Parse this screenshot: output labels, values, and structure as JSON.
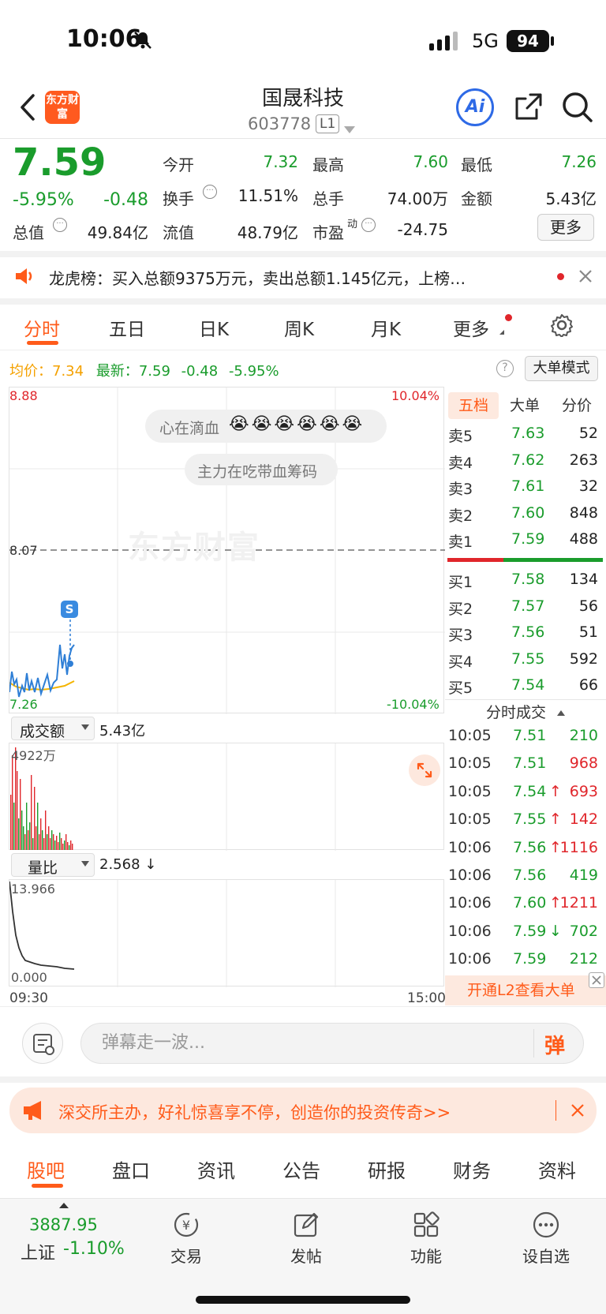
{
  "status": {
    "time": "10:06",
    "network": "5G",
    "battery": "94"
  },
  "header": {
    "title": "国晟科技",
    "code": "603778",
    "level": "L1",
    "logo_text": "东方财富",
    "ai_label": "Ai"
  },
  "quote": {
    "price": "7.59",
    "change_pct": "-5.95%",
    "change": "-0.48",
    "open_label": "今开",
    "open": "7.32",
    "high_label": "最高",
    "high": "7.60",
    "low_label": "最低",
    "low": "7.26",
    "turnover_label": "换手",
    "turnover": "11.51%",
    "volume_label": "总手",
    "volume": "74.00万",
    "amount_label": "金额",
    "amount": "5.43亿",
    "mktcap_label": "总值",
    "mktcap": "49.84亿",
    "float_label": "流值",
    "float": "48.79亿",
    "pe_label": "市盈",
    "pe_sup": "动",
    "pe": "-24.75",
    "more_label": "更多"
  },
  "notice": {
    "text": "龙虎榜：买入总额9375万元，卖出总额1.145亿元，上榜…"
  },
  "tabs": [
    "分时",
    "五日",
    "日K",
    "周K",
    "月K",
    "更多"
  ],
  "avg": {
    "avg_label": "均价：",
    "avg_value": "7.34",
    "latest_label": "最新：",
    "latest_value": "7.59",
    "change": "-0.48",
    "change_pct": "-5.95%"
  },
  "mode_button": "大单模式",
  "chart": {
    "price_high": "8.88",
    "price_mid": "8.07",
    "price_low": "7.26",
    "pct_high": "10.04%",
    "pct_low": "-10.04%",
    "watermark": "东方财富",
    "bubble1": "心在滴血",
    "bubble2": "主力在吃带血筹码",
    "signal": "S",
    "colors": {
      "price_line": "#2f7fd6",
      "avg_line": "#f4b400",
      "up": "#e0262b",
      "down": "#1a9c2c"
    },
    "volume_label": "成交额",
    "volume_total": "5.43亿",
    "volume_max": "4922万",
    "ratio_label": "量比",
    "ratio_value": "2.568 ↓",
    "ratio_max": "13.966",
    "ratio_min": "0.000",
    "time_start": "09:30",
    "time_end": "15:00"
  },
  "orderbook": {
    "tabs": [
      "五档",
      "大单",
      "分价"
    ],
    "asks": [
      {
        "label": "卖5",
        "price": "7.63",
        "vol": "52"
      },
      {
        "label": "卖4",
        "price": "7.62",
        "vol": "263"
      },
      {
        "label": "卖3",
        "price": "7.61",
        "vol": "32"
      },
      {
        "label": "卖2",
        "price": "7.60",
        "vol": "848"
      },
      {
        "label": "卖1",
        "price": "7.59",
        "vol": "488"
      }
    ],
    "bids": [
      {
        "label": "买1",
        "price": "7.58",
        "vol": "134"
      },
      {
        "label": "买2",
        "price": "7.57",
        "vol": "56"
      },
      {
        "label": "买3",
        "price": "7.56",
        "vol": "51"
      },
      {
        "label": "买4",
        "price": "7.55",
        "vol": "592"
      },
      {
        "label": "买5",
        "price": "7.54",
        "vol": "66"
      }
    ]
  },
  "trades": {
    "title": "分时成交",
    "rows": [
      {
        "time": "10:05",
        "price": "7.51",
        "arrow": "",
        "vol": "210",
        "dir": "down"
      },
      {
        "time": "10:05",
        "price": "7.51",
        "arrow": "",
        "vol": "968",
        "dir": "up"
      },
      {
        "time": "10:05",
        "price": "7.54",
        "arrow": "↑",
        "vol": "693",
        "dir": "up"
      },
      {
        "time": "10:05",
        "price": "7.55",
        "arrow": "↑",
        "vol": "142",
        "dir": "up"
      },
      {
        "time": "10:06",
        "price": "7.56",
        "arrow": "↑",
        "vol": "1116",
        "dir": "up"
      },
      {
        "time": "10:06",
        "price": "7.56",
        "arrow": "",
        "vol": "419",
        "dir": "down"
      },
      {
        "time": "10:06",
        "price": "7.60",
        "arrow": "↑",
        "vol": "1211",
        "dir": "up"
      },
      {
        "time": "10:06",
        "price": "7.59",
        "arrow": "↓",
        "vol": "702",
        "dir": "down"
      },
      {
        "time": "10:06",
        "price": "7.59",
        "arrow": "",
        "vol": "212",
        "dir": "down"
      }
    ],
    "l2_banner": "开通L2查看大单"
  },
  "barrage": {
    "placeholder": "弹幕走一波...",
    "send": "弹"
  },
  "ad": {
    "text": "深交所主办，好礼惊喜享不停，创造你的投资传奇>>"
  },
  "subtabs": [
    "股吧",
    "盘口",
    "资讯",
    "公告",
    "研报",
    "财务",
    "资料"
  ],
  "bottom": {
    "index_value": "3887.95",
    "index_name": "上证",
    "index_change": "-1.10%",
    "nav": [
      "交易",
      "发帖",
      "功能",
      "设自选"
    ]
  }
}
